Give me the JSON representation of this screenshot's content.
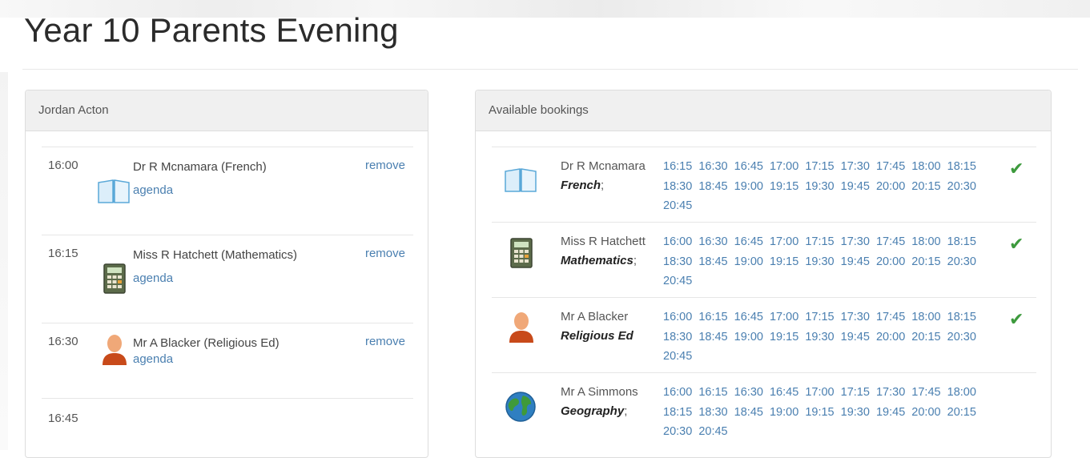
{
  "page": {
    "title": "Year 10 Parents Evening"
  },
  "left_panel": {
    "heading": "Jordan Acton",
    "slots": [
      {
        "time": "16:00",
        "teacher": "Dr R Mcnamara (French)",
        "agenda": "agenda",
        "remove": "remove",
        "icon": "book-icon"
      },
      {
        "time": "16:15",
        "teacher": "Miss R Hatchett (Mathematics)",
        "agenda": "agenda",
        "remove": "remove",
        "icon": "calculator-icon"
      },
      {
        "time": "16:30",
        "teacher": "Mr A Blacker (Religious Ed)",
        "agenda": "agenda",
        "remove": "remove",
        "icon": "person-icon"
      },
      {
        "time": "16:45"
      }
    ]
  },
  "right_panel": {
    "heading": "Available bookings",
    "rows": [
      {
        "name": "Dr R Mcnamara",
        "subject": "French",
        "suffix": ";",
        "icon": "book-icon",
        "booked": true,
        "times": [
          "16:15",
          "16:30",
          "16:45",
          "17:00",
          "17:15",
          "17:30",
          "17:45",
          "18:00",
          "18:15",
          "18:30",
          "18:45",
          "19:00",
          "19:15",
          "19:30",
          "19:45",
          "20:00",
          "20:15",
          "20:30",
          "20:45"
        ]
      },
      {
        "name": "Miss R Hatchett",
        "subject": "Mathematics",
        "suffix": ";",
        "icon": "calculator-icon",
        "booked": true,
        "times": [
          "16:00",
          "16:30",
          "16:45",
          "17:00",
          "17:15",
          "17:30",
          "17:45",
          "18:00",
          "18:15",
          "18:30",
          "18:45",
          "19:00",
          "19:15",
          "19:30",
          "19:45",
          "20:00",
          "20:15",
          "20:30",
          "20:45"
        ]
      },
      {
        "name": "Mr A Blacker",
        "subject": "Religious Ed",
        "suffix": "",
        "icon": "person-icon",
        "booked": true,
        "times": [
          "16:00",
          "16:15",
          "16:45",
          "17:00",
          "17:15",
          "17:30",
          "17:45",
          "18:00",
          "18:15",
          "18:30",
          "18:45",
          "19:00",
          "19:15",
          "19:30",
          "19:45",
          "20:00",
          "20:15",
          "20:30",
          "20:45"
        ]
      },
      {
        "name": "Mr A Simmons",
        "subject": "Geography",
        "suffix": ";",
        "icon": "globe-icon",
        "booked": false,
        "times": [
          "16:00",
          "16:15",
          "16:30",
          "16:45",
          "17:00",
          "17:15",
          "17:30",
          "17:45",
          "18:00",
          "18:15",
          "18:30",
          "18:45",
          "19:00",
          "19:15",
          "19:30",
          "19:45",
          "20:00",
          "20:15",
          "20:30",
          "20:45"
        ]
      }
    ]
  },
  "colors": {
    "link": "#4a7fb0",
    "check": "#3d9a3d",
    "heading_bg": "#f0f0f0"
  }
}
